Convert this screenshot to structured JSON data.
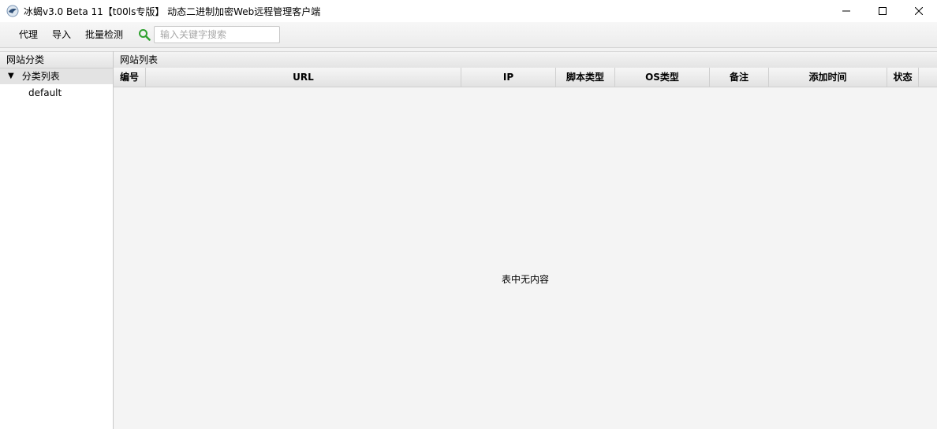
{
  "window": {
    "title": "冰蝎v3.0 Beta 11【t00ls专版】 动态二进制加密Web远程管理客户端",
    "minimize_icon": "minimize-icon",
    "maximize_icon": "maximize-icon",
    "close_icon": "close-icon"
  },
  "menubar": {
    "items": [
      "代理",
      "导入",
      "批量检测"
    ],
    "search_placeholder": "输入关键字搜索",
    "search_value": ""
  },
  "sidebar": {
    "header": "网站分类",
    "tree": {
      "root_label": "分类列表",
      "children": [
        "default"
      ]
    }
  },
  "main": {
    "header": "网站列表",
    "columns": [
      "编号",
      "URL",
      "IP",
      "脚本类型",
      "OS类型",
      "备注",
      "添加时间",
      "状态"
    ],
    "empty_message": "表中无内容"
  }
}
